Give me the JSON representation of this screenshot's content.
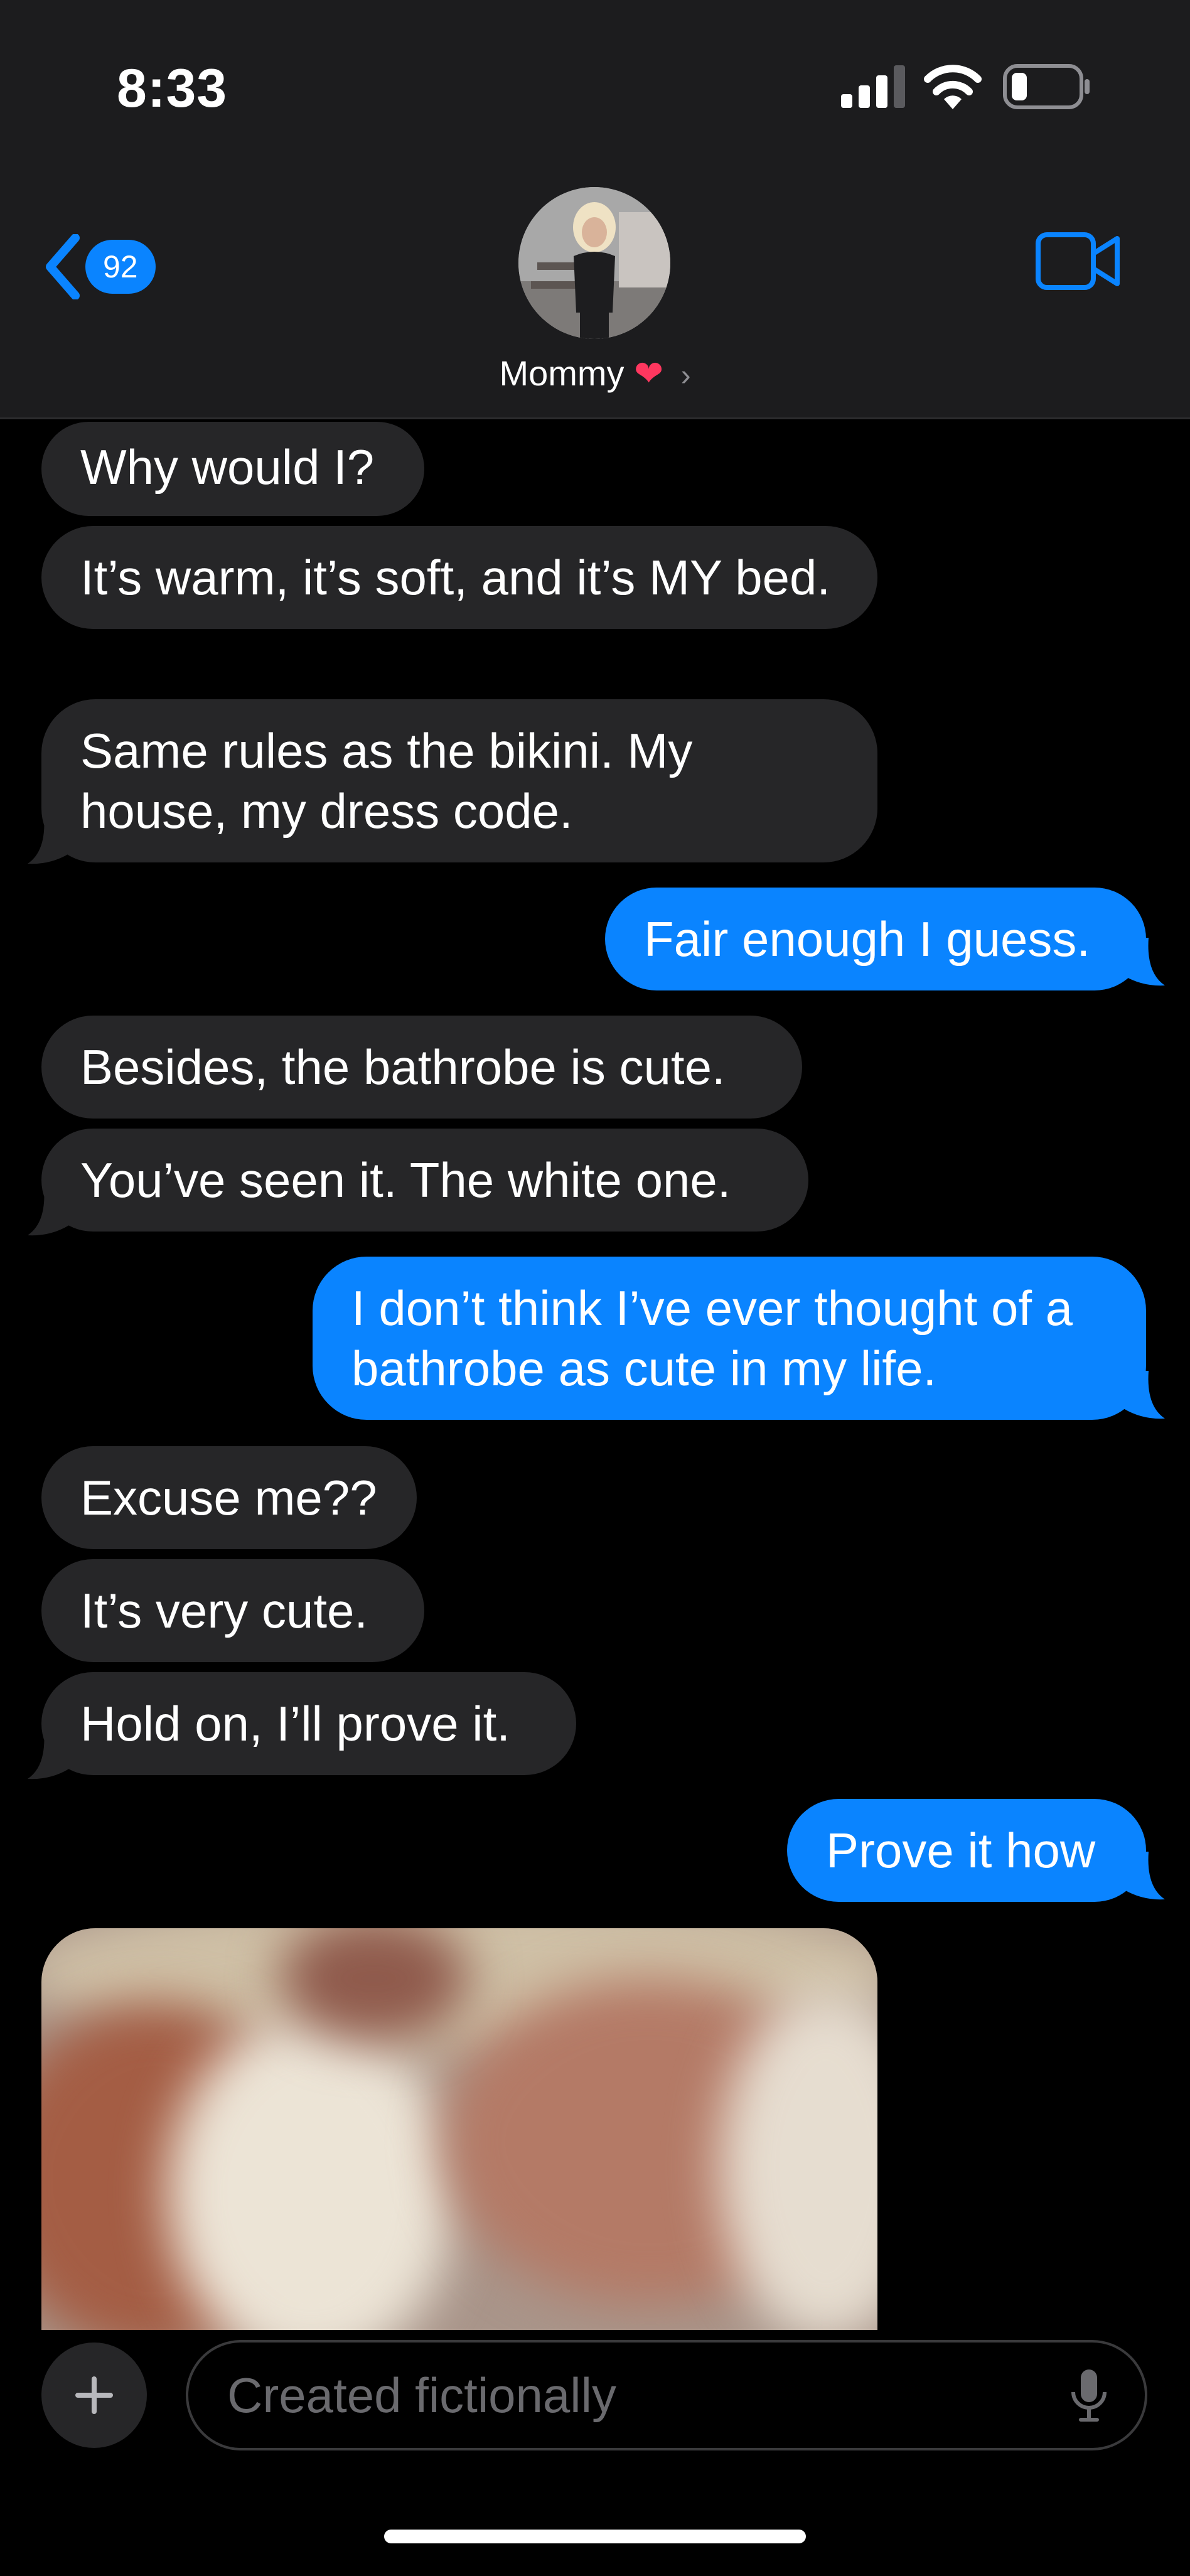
{
  "status": {
    "time": "8:33"
  },
  "header": {
    "back_count": "92",
    "contact_name": "Mommy",
    "contact_emoji": "❤"
  },
  "messages": [
    {
      "from": "them",
      "text": "Why would I?"
    },
    {
      "from": "them",
      "text": "It’s warm, it’s soft, and it’s MY bed."
    },
    {
      "from": "them",
      "text": "Same rules as the bikini. My house, my dress code."
    },
    {
      "from": "me",
      "text": "Fair enough I guess."
    },
    {
      "from": "them",
      "text": "Besides, the bathrobe is cute."
    },
    {
      "from": "them",
      "text": "You’ve seen it. The white one."
    },
    {
      "from": "me",
      "text": "I don’t think I’ve ever thought of a bathrobe as cute in my life."
    },
    {
      "from": "them",
      "text": "Excuse me??"
    },
    {
      "from": "them",
      "text": "It’s very cute."
    },
    {
      "from": "them",
      "text": "Hold on, I’ll prove it."
    },
    {
      "from": "me",
      "text": "Prove it how"
    }
  ],
  "input": {
    "placeholder": "Created fictionally"
  },
  "colors": {
    "sent": "#0a84ff",
    "received": "#262628",
    "background": "#000000",
    "header": "#1c1c1e"
  }
}
